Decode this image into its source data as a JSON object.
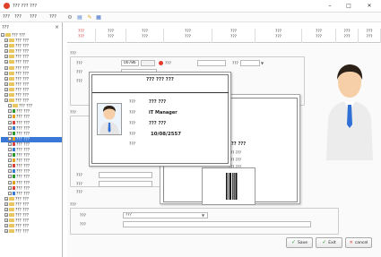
{
  "window": {
    "title": "??? ??? ???",
    "minimize": "–",
    "maximize": "□",
    "close": "✕"
  },
  "menu": {
    "items": [
      "???",
      "???",
      "???",
      "???"
    ],
    "toolbar_icons": [
      "settings-icon",
      "document-icon",
      "pencil-icon",
      "grid-icon"
    ]
  },
  "sidebar": {
    "header": "???",
    "close": "×",
    "selected_label": "???",
    "selected_color": "#3a78d8",
    "items": [
      {
        "label": "??? ???"
      },
      {
        "label": "??? ???"
      },
      {
        "label": "??? ???"
      },
      {
        "label": "??? ???"
      },
      {
        "label": "??? ???"
      },
      {
        "label": "??? ???"
      },
      {
        "label": "??? ???"
      },
      {
        "label": "??? ???"
      },
      {
        "label": "??? ???"
      },
      {
        "label": "??? ???"
      },
      {
        "label": "??? ???"
      },
      {
        "label": "??? ???"
      },
      {
        "label": "??? ???"
      },
      {
        "label": "??? ???"
      },
      {
        "label": "??? ???"
      },
      {
        "label": "??? ???"
      },
      {
        "label": "??? ???"
      },
      {
        "label": "??? ???"
      },
      {
        "label": "??? ???"
      },
      {
        "label": "??? ???"
      },
      {
        "label": "??? ???"
      },
      {
        "label": "??? ???"
      },
      {
        "label": "??? ???"
      },
      {
        "label": "??? ???"
      },
      {
        "label": "??? ???"
      },
      {
        "label": "??? ???"
      },
      {
        "label": "??? ???"
      },
      {
        "label": "??? ???"
      },
      {
        "label": "??? ???"
      },
      {
        "label": "??? ???"
      },
      {
        "label": "??? ???"
      },
      {
        "label": "??? ???"
      },
      {
        "label": "??? ???"
      },
      {
        "label": "??? ???"
      },
      {
        "label": "??? ???"
      },
      {
        "label": "??? ???"
      },
      {
        "label": "??? ???"
      }
    ]
  },
  "tabs": {
    "active_color": "#d12020",
    "items": [
      {
        "top": "???",
        "bottom": "???"
      },
      {
        "top": "???",
        "bottom": "???"
      },
      {
        "top": "???",
        "bottom": "???"
      },
      {
        "top": "???",
        "bottom": "???"
      },
      {
        "top": "???",
        "bottom": "???"
      },
      {
        "top": "???",
        "bottom": "???"
      },
      {
        "top": "???",
        "bottom": "???"
      },
      {
        "top": "???",
        "bottom": "???"
      },
      {
        "top": "???",
        "bottom": "???"
      }
    ]
  },
  "form": {
    "section1_title": "???",
    "id_label": "???",
    "id_value": "00786",
    "field2_label": "???",
    "field3_label": "???",
    "field4_label": "???",
    "field5_label": "???",
    "section2_title": "???",
    "field6_label": "???",
    "field7_label": "???",
    "field8_label": "???",
    "section3_title": "???",
    "select1_label": "???",
    "select1_value": "???",
    "select2_label": "???"
  },
  "card_front": {
    "company": "??? ??? ???",
    "row1_label": "???",
    "row1_value": "??? ???",
    "row2_label": "???",
    "row2_value": "IT Manager",
    "row3_label": "???",
    "row3_value": "??? ???",
    "row4_label": "???",
    "row4_value": "10/08/2557",
    "row5_label": "???"
  },
  "card_back": {
    "header": "??? ???",
    "line1": "??? ???",
    "line2": "??? ???",
    "line3": "??? ???",
    "note": "1. ??? ???"
  },
  "buttons": {
    "save": "Save",
    "exit": "Exit",
    "cancel": "cancel"
  }
}
